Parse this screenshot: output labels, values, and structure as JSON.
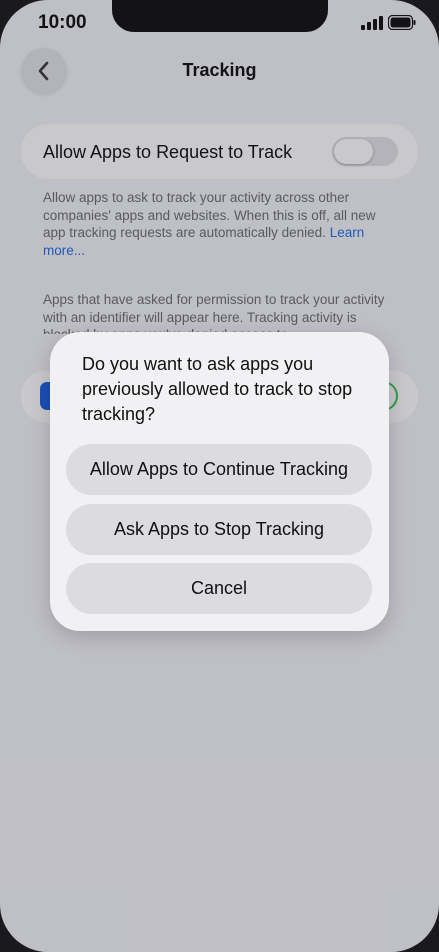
{
  "status_bar": {
    "time": "10:00"
  },
  "nav": {
    "title": "Tracking",
    "back_icon": "chevron-left-icon"
  },
  "toggle_card": {
    "label": "Allow Apps to Request to Track",
    "enabled": false
  },
  "description": {
    "text": "Allow apps to ask to track your activity across other companies' apps and websites. When this is off, all new app tracking requests are automatically denied.",
    "link": "Learn more..."
  },
  "apps_section": {
    "text": "Apps that have asked for permission to track your activity with an identifier will appear here. Tracking activity is blocked by apps you've denied access to."
  },
  "dialog": {
    "message": "Do you want to ask apps you previously allowed to track to stop tracking?",
    "buttons": {
      "continue": "Allow Apps to Continue Tracking",
      "stop": "Ask Apps to Stop Tracking",
      "cancel": "Cancel"
    }
  },
  "colors": {
    "accent": "#1f6fe5",
    "toggle_on": "#34c759",
    "background": "#f2f2f7"
  }
}
